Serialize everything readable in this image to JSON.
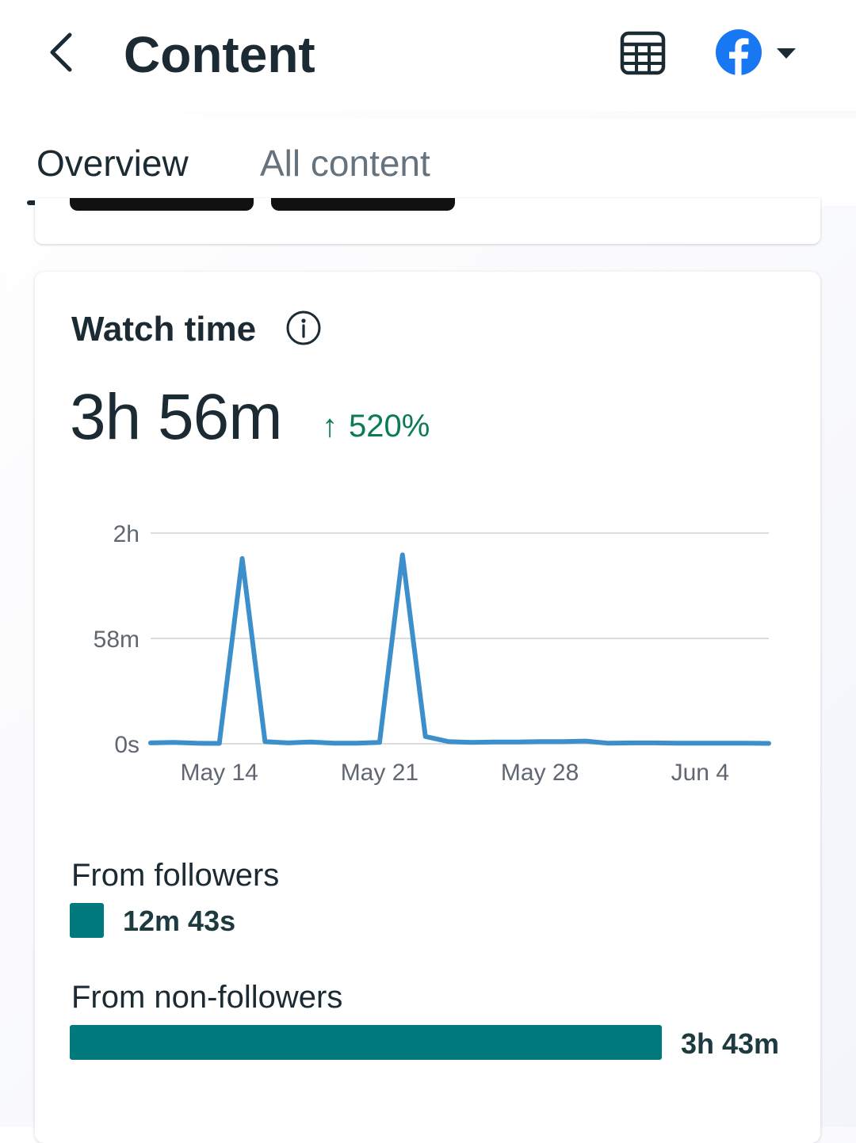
{
  "header": {
    "title": "Content",
    "back_icon": "chevron-left-icon",
    "table_icon": "table-icon",
    "account_icon": "facebook-icon",
    "account_dropdown_icon": "caret-down-icon"
  },
  "tabs": [
    {
      "label": "Overview",
      "selected": true
    },
    {
      "label": "All content",
      "selected": false
    }
  ],
  "watch_time": {
    "title": "Watch time",
    "info_icon": "info-icon",
    "total": "3h 56m",
    "change_arrow": "↑",
    "change": "520%",
    "change_color": "#0a7c55"
  },
  "chart_data": {
    "type": "line",
    "y_tick_labels": [
      "2h",
      "58m",
      "0s"
    ],
    "y_tick_values_minutes": [
      116,
      58,
      0
    ],
    "ylim_minutes": [
      0,
      116
    ],
    "x_tick_labels": [
      "May 14",
      "May 21",
      "May 28",
      "Jun 4"
    ],
    "x_dates": [
      "May 11",
      "May 12",
      "May 13",
      "May 14",
      "May 15",
      "May 16",
      "May 17",
      "May 18",
      "May 19",
      "May 20",
      "May 21",
      "May 22",
      "May 23",
      "May 24",
      "May 25",
      "May 26",
      "May 27",
      "May 28",
      "May 29",
      "May 30",
      "May 31",
      "Jun 1",
      "Jun 2",
      "Jun 3",
      "Jun 4",
      "Jun 5",
      "Jun 6",
      "Jun 7"
    ],
    "series": [
      {
        "color": "#3d8fcc",
        "values_minutes": [
          0.5,
          0.8,
          0.3,
          0.2,
          102,
          1.2,
          0.5,
          1.0,
          0.3,
          0.3,
          0.8,
          104,
          4,
          1.2,
          0.8,
          1.0,
          1.0,
          1.2,
          1.2,
          1.5,
          0.3,
          0.5,
          0.5,
          0.3,
          0.3,
          0.3,
          0.3,
          0.2
        ]
      }
    ],
    "grid": true,
    "gridline_color": "#d9dde1",
    "axis_text_color": "#606770"
  },
  "breakdown": {
    "followers": {
      "label": "From followers",
      "value": "12m 43s",
      "fraction": 0.0539
    },
    "non_followers": {
      "label": "From non-followers",
      "value": "3h 43m",
      "fraction": 0.9461
    },
    "bar_color": "#007a7c"
  }
}
